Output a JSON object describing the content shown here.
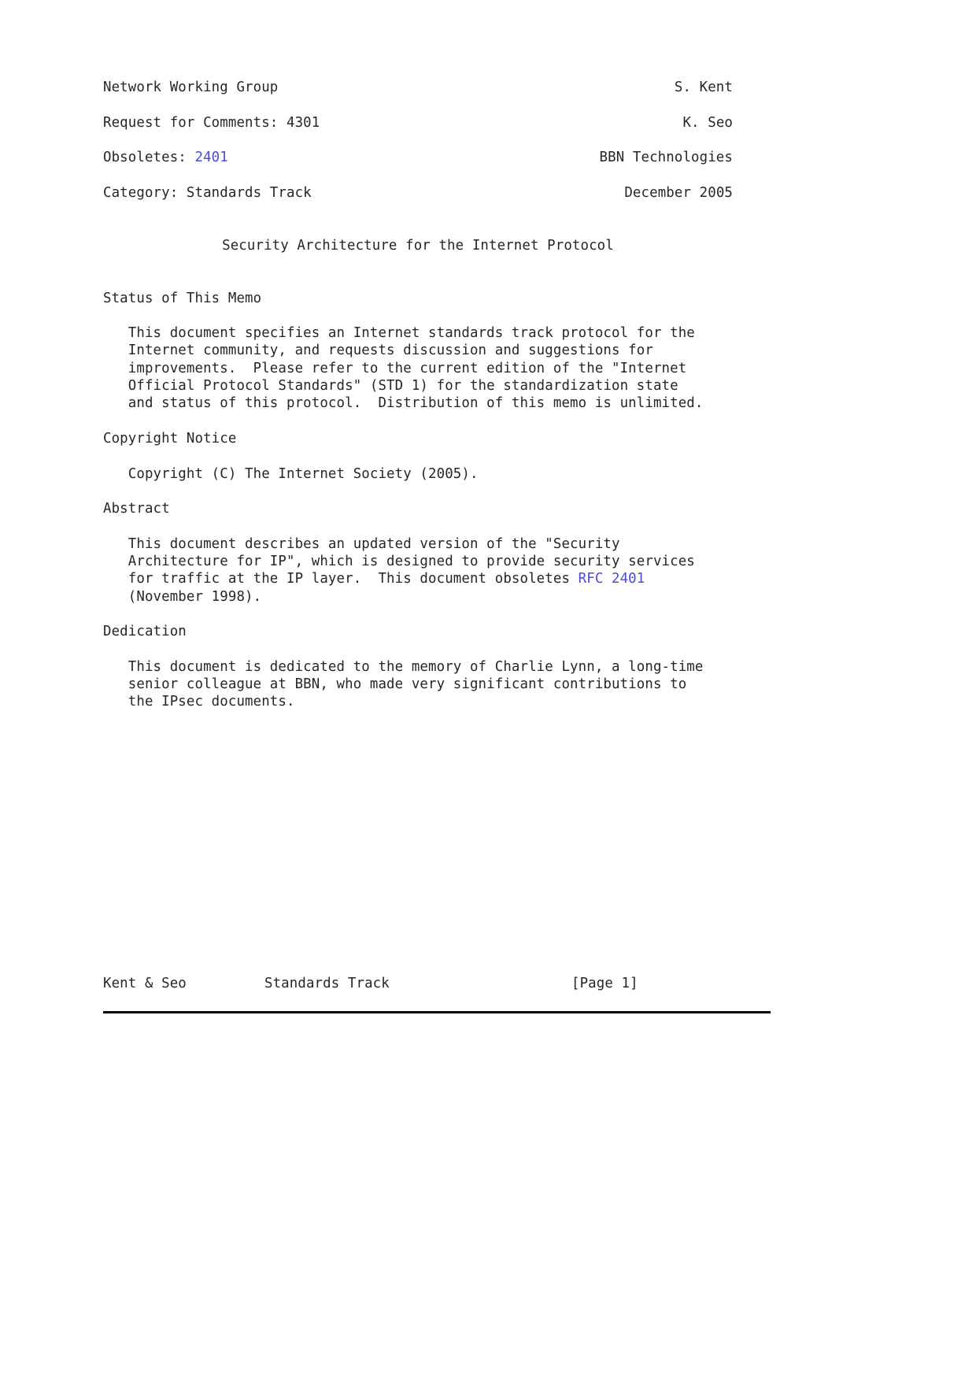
{
  "document": {
    "header": {
      "left_lines": [
        "Network Working Group",
        "Request for Comments: 4301",
        "Obsoletes: ",
        "Category: Standards Track"
      ],
      "obsoletes_link": "2401",
      "right_lines": [
        "S. Kent",
        "K. Seo",
        "BBN Technologies",
        "December 2005"
      ]
    },
    "title": "Security Architecture for the Internet Protocol",
    "sections": [
      {
        "heading": "Status of This Memo",
        "body": "   This document specifies an Internet standards track protocol for the\n   Internet community, and requests discussion and suggestions for\n   improvements.  Please refer to the current edition of the \"Internet\n   Official Protocol Standards\" (STD 1) for the standardization state\n   and status of this protocol.  Distribution of this memo is unlimited."
      },
      {
        "heading": "Copyright Notice",
        "body": "   Copyright (C) The Internet Society (2005)."
      },
      {
        "heading": "Abstract",
        "body_before_link": "   This document describes an updated version of the \"Security\n   Architecture for IP\", which is designed to provide security services\n   for traffic at the IP layer.  This document obsoletes ",
        "link": "RFC 2401",
        "body_after_link": "\n   (November 1998)."
      },
      {
        "heading": "Dedication",
        "body": "   This document is dedicated to the memory of Charlie Lynn, a long-time\n   senior colleague at BBN, who made very significant contributions to\n   the IPsec documents."
      }
    ],
    "footer": {
      "authors": "Kent & Seo",
      "category": "Standards Track",
      "page": "[Page 1]"
    },
    "colors": {
      "text": "#262626",
      "link": "#4b4bd4",
      "rule": "#000000",
      "background": "#ffffff"
    }
  }
}
